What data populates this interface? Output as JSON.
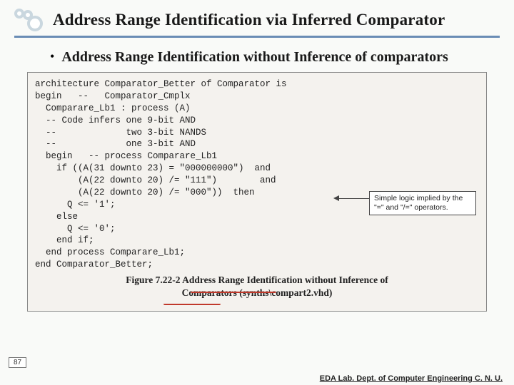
{
  "slide": {
    "title": "Address Range Identification via Inferred Comparator",
    "bullet": "Address Range Identification without Inference of comparators",
    "page_number": "87",
    "footer": "EDA Lab. Dept. of Computer Engineering C. N. U."
  },
  "code": {
    "l01": "architecture Comparator_Better of Comparator is",
    "l02": "begin   --   Comparator_Cmplx",
    "l03": "  Comparare_Lb1 : process (A)",
    "l04": "  -- Code infers one 9-bit AND",
    "l05": "  --             two 3-bit NANDS",
    "l06": "  --             one 3-bit AND",
    "l07": "",
    "l08": "  begin   -- process Comparare_Lb1",
    "l09": "    if ((A(31 downto 23) = \"000000000\")  and",
    "l10": "        (A(22 downto 20) /= \"111\")        and",
    "l11": "        (A(22 downto 20) /= \"000\"))  then",
    "l12": "      Q <= '1';",
    "l13": "    else",
    "l14": "      Q <= '0';",
    "l15": "    end if;",
    "l16": "  end process Comparare_Lb1;",
    "l17": "end Comparator_Better;"
  },
  "callout": {
    "line1": "Simple logic implied by the",
    "line2": "\"=\" and \"/=\" operators."
  },
  "caption": {
    "line1": "Figure 7.22-2 Address Range Identification without Inference of",
    "line2": "Comparators (synths\\compart2.vhd)"
  }
}
